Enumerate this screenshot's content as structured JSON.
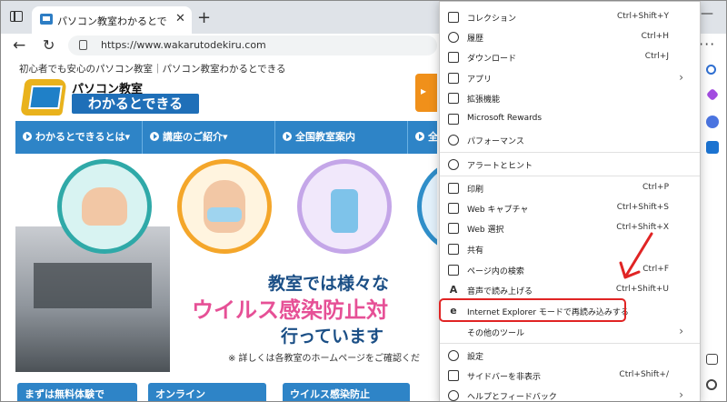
{
  "browser": {
    "tab_title": "パソコン教室わかるとできる｜初心者",
    "tab_close": "✕",
    "new_tab": "+",
    "url": "https://www.wakarutodekiru.com",
    "more_menu": "···",
    "minimize": "—"
  },
  "page": {
    "tagline": "初心者でも安心のパソコン教室｜パソコン教室わかるとできる",
    "logo_top": "パソコン教室",
    "logo_main": "わかるとできる",
    "nav": [
      {
        "label": "わかるとできるとは▾"
      },
      {
        "label": "講座のご紹介▾"
      },
      {
        "label": "全国教室案内"
      },
      {
        "label": "全"
      }
    ],
    "hero": {
      "line1": "教室では様々な",
      "line2": "ウイルス感染防止対",
      "line3": "行っています",
      "note": "※ 詳しくは各教室のホームページをご確認くだ"
    },
    "cards": [
      {
        "label": "まずは無料体験で"
      },
      {
        "label": "オンライン"
      },
      {
        "label": "ウイルス感染防止"
      }
    ]
  },
  "menu": {
    "items": [
      {
        "label": "コレクション",
        "shortcut": "Ctrl+Shift+Y",
        "icon": "collections-icon"
      },
      {
        "label": "履歴",
        "shortcut": "Ctrl+H",
        "icon": "history-icon"
      },
      {
        "label": "ダウンロード",
        "shortcut": "Ctrl+J",
        "icon": "download-icon"
      },
      {
        "label": "アプリ",
        "shortcut": "",
        "icon": "apps-icon"
      },
      {
        "label": "拡張機能",
        "shortcut": "",
        "icon": "extensions-icon"
      },
      {
        "label": "Microsoft Rewards",
        "shortcut": "",
        "icon": "rewards-icon"
      },
      {
        "label": "パフォーマンス",
        "shortcut": "",
        "icon": "performance-icon"
      },
      {
        "label": "アラートとヒント",
        "shortcut": "",
        "icon": "bell-icon"
      },
      {
        "label": "印刷",
        "shortcut": "Ctrl+P",
        "icon": "print-icon"
      },
      {
        "label": "Web キャプチャ",
        "shortcut": "Ctrl+Shift+S",
        "icon": "capture-icon"
      },
      {
        "label": "Web 選択",
        "shortcut": "Ctrl+Shift+X",
        "icon": "select-icon"
      },
      {
        "label": "共有",
        "shortcut": "",
        "icon": "share-icon"
      },
      {
        "label": "ページ内の検索",
        "shortcut": "Ctrl+F",
        "icon": "find-icon"
      },
      {
        "label": "音声で読み上げる",
        "shortcut": "Ctrl+Shift+U",
        "icon": "read-aloud-icon"
      },
      {
        "label": "Internet Explorer モードで再読み込みする",
        "shortcut": "",
        "icon": "ie-icon"
      },
      {
        "label": "その他のツール",
        "shortcut": "",
        "icon": "tools-icon"
      },
      {
        "label": "設定",
        "shortcut": "",
        "icon": "gear-icon"
      },
      {
        "label": "サイドバーを非表示",
        "shortcut": "Ctrl+Shift+/",
        "icon": "sidebar-icon"
      },
      {
        "label": "ヘルプとフィードバック",
        "shortcut": "",
        "icon": "help-icon"
      }
    ],
    "chevron": "›",
    "icon_glyphs": {
      "read_aloud": "A",
      "ie": "e"
    }
  },
  "colors": {
    "nav_blue": "#2e84c7",
    "highlight_red": "#e02424",
    "hero_pink": "#e65096",
    "hero_navy": "#1b4f86"
  }
}
